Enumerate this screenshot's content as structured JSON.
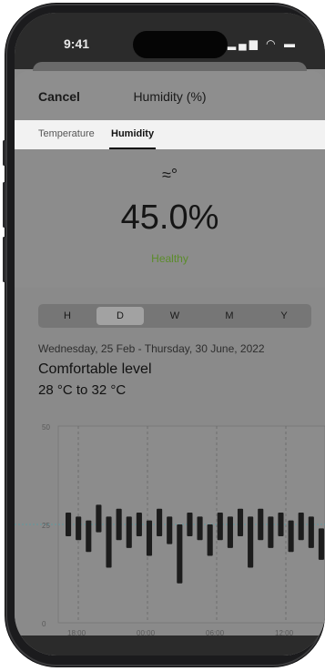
{
  "status_bar": {
    "time": "9:41",
    "icons": "▂▄▆ ◠ ▬"
  },
  "header": {
    "cancel_label": "Cancel",
    "title": "Humidity (%)"
  },
  "tabs": [
    {
      "label": "Temperature",
      "active": false
    },
    {
      "label": "Humidity",
      "active": true
    }
  ],
  "summary": {
    "icon": "humidity-icon",
    "icon_glyph": "≈°",
    "value": "45.0%",
    "status": "Healthy",
    "status_color": "#5b8c2a"
  },
  "segments": [
    {
      "label": "H",
      "active": false
    },
    {
      "label": "D",
      "active": true
    },
    {
      "label": "W",
      "active": false
    },
    {
      "label": "M",
      "active": false
    },
    {
      "label": "Y",
      "active": false
    }
  ],
  "range_text": "Wednesday, 25 Feb - Thursday, 30 June, 2022",
  "level_title": "Comfortable level",
  "temp_range": "28 °C to 32 °C",
  "chart_data": {
    "type": "bar",
    "ylim": [
      0,
      50
    ],
    "y_ticks": [
      "50",
      "25",
      "0"
    ],
    "x_ticks": [
      "18:00",
      "00:00",
      "06:00",
      "12:00"
    ],
    "reference_line": 25,
    "series": [
      {
        "values": [
          [
            22,
            28
          ],
          [
            21,
            27
          ],
          [
            18,
            26
          ],
          [
            23,
            30
          ],
          [
            14,
            27
          ],
          [
            21,
            29
          ],
          [
            19,
            27
          ],
          [
            22,
            28
          ],
          [
            17,
            26
          ],
          [
            22,
            29
          ],
          [
            20,
            27
          ],
          [
            10,
            25
          ],
          [
            22,
            28
          ],
          [
            21,
            27
          ],
          [
            17,
            25
          ],
          [
            21,
            28
          ],
          [
            19,
            27
          ],
          [
            22,
            29
          ],
          [
            14,
            27
          ],
          [
            21,
            29
          ],
          [
            19,
            27
          ],
          [
            22,
            28
          ],
          [
            18,
            26
          ],
          [
            21,
            28
          ],
          [
            19,
            27
          ],
          [
            16,
            24
          ]
        ]
      }
    ]
  }
}
